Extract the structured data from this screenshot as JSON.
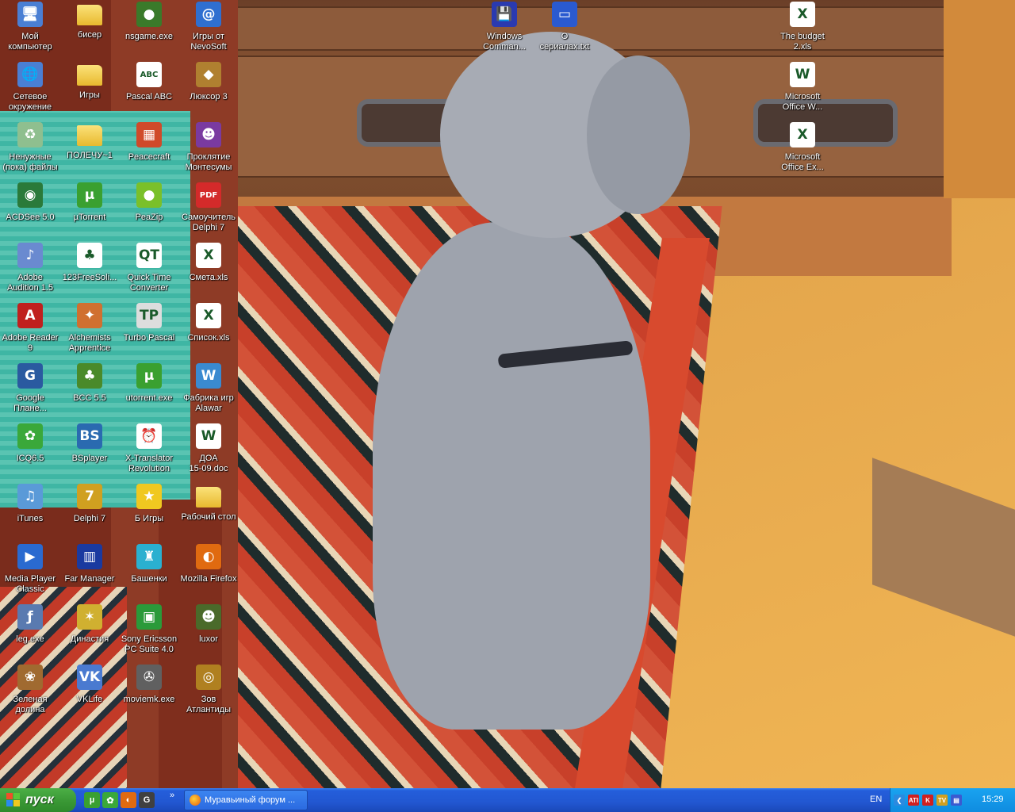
{
  "desktop_icons": [
    {
      "label": "Мой\nкомпьютер",
      "icon": "my-computer-icon",
      "color": "#4a7fd4",
      "glyph": "🖥"
    },
    {
      "label": "бисер",
      "icon": "folder-icon",
      "color": "#f0c846",
      "glyph": ""
    },
    {
      "label": "nsgame.exe",
      "icon": "nsgame-icon",
      "color": "#3a7a2a",
      "glyph": "●"
    },
    {
      "label": "Игры от\nNevoSoft",
      "icon": "nevosoft-icon",
      "color": "#2f6fd0",
      "glyph": "@"
    },
    {
      "label": "Сетевое\nокружение",
      "icon": "network-places-icon",
      "color": "#4a7fd4",
      "glyph": "🌐"
    },
    {
      "label": "Игры",
      "icon": "folder-icon",
      "color": "#f0c846",
      "glyph": ""
    },
    {
      "label": "Pascal ABC",
      "icon": "pascal-abc-icon",
      "color": "#ffffff",
      "glyph": "ABC"
    },
    {
      "label": "Люксор 3",
      "icon": "luxor3-icon",
      "color": "#b08030",
      "glyph": "◆"
    },
    {
      "label": "Ненужные\n(пока) файлы",
      "icon": "recycle-bin-icon",
      "color": "#8fbf8f",
      "glyph": "♻"
    },
    {
      "label": "ПОЛЕЧУ~1",
      "icon": "folder-icon",
      "color": "#f0c846",
      "glyph": ""
    },
    {
      "label": "Peacecraft",
      "icon": "peacecraft-icon",
      "color": "#d04a2a",
      "glyph": "▦"
    },
    {
      "label": "Проклятие\nМонтесумы",
      "icon": "montezuma-icon",
      "color": "#7a3aa0",
      "glyph": "☻"
    },
    {
      "label": "ACDSee 5.0",
      "icon": "acdsee-icon",
      "color": "#2a7a3a",
      "glyph": "◉"
    },
    {
      "label": "µTorrent",
      "icon": "utorrent-icon",
      "color": "#3aa030",
      "glyph": "µ"
    },
    {
      "label": "PeaZip",
      "icon": "peazip-icon",
      "color": "#7ac02a",
      "glyph": "●"
    },
    {
      "label": "Самоучитель\nDelphi 7",
      "icon": "pdf-icon",
      "color": "#d42a2a",
      "glyph": "PDF"
    },
    {
      "label": "Adobe\nAudition 1.5",
      "icon": "adobe-audition-icon",
      "color": "#6a8ad0",
      "glyph": "♪"
    },
    {
      "label": "123FreeSoli...",
      "icon": "solitaire-icon",
      "color": "#ffffff",
      "glyph": "♣"
    },
    {
      "label": "Quick Time\nConverter",
      "icon": "quicktime-converter-icon",
      "color": "#ffffff",
      "glyph": "QT"
    },
    {
      "label": "Смета.xls",
      "icon": "excel-file-icon",
      "color": "#ffffff",
      "glyph": "X"
    },
    {
      "label": "Adobe Reader\n9",
      "icon": "adobe-reader-icon",
      "color": "#c0201e",
      "glyph": "A"
    },
    {
      "label": "Alchemists\nApprentice",
      "icon": "alchemists-icon",
      "color": "#d07030",
      "glyph": "✦"
    },
    {
      "label": "Turbo Pascal",
      "icon": "turbo-pascal-icon",
      "color": "#dddddd",
      "glyph": "TP"
    },
    {
      "label": "Список.xls",
      "icon": "excel-file-icon",
      "color": "#ffffff",
      "glyph": "X"
    },
    {
      "label": "Google\nПлане...",
      "icon": "google-earth-icon",
      "color": "#2a5aa0",
      "glyph": "G"
    },
    {
      "label": "BCC 5.5",
      "icon": "bcc-icon",
      "color": "#4a8a2a",
      "glyph": "♣"
    },
    {
      "label": "utorrent.exe",
      "icon": "utorrent-icon",
      "color": "#3aa030",
      "glyph": "µ"
    },
    {
      "label": "Фабрика игр\nAlawar",
      "icon": "alawar-icon",
      "color": "#3a8ad0",
      "glyph": "W"
    },
    {
      "label": "ICQ6.5",
      "icon": "icq-icon",
      "color": "#3aa83a",
      "glyph": "✿"
    },
    {
      "label": "BSplayer",
      "icon": "bsplayer-icon",
      "color": "#2a6ab0",
      "glyph": "BS"
    },
    {
      "label": "X-Translator\nRevolution",
      "icon": "clock-icon",
      "color": "#ffffff",
      "glyph": "⏰"
    },
    {
      "label": "ДОА\n15-09.doc",
      "icon": "word-file-icon",
      "color": "#ffffff",
      "glyph": "W"
    },
    {
      "label": "iTunes",
      "icon": "itunes-icon",
      "color": "#5a9ad8",
      "glyph": "♫"
    },
    {
      "label": "Delphi 7",
      "icon": "delphi-icon",
      "color": "#d0a020",
      "glyph": "7"
    },
    {
      "label": "Б Игры",
      "icon": "star-icon",
      "color": "#f0c820",
      "glyph": "★"
    },
    {
      "label": "Рабочий стол",
      "icon": "folder-icon",
      "color": "#f0c846",
      "glyph": ""
    },
    {
      "label": "Media Player\nClassic",
      "icon": "media-player-icon",
      "color": "#2a6ad0",
      "glyph": "▶"
    },
    {
      "label": "Far Manager",
      "icon": "far-manager-icon",
      "color": "#1a3aa0",
      "glyph": "▥"
    },
    {
      "label": "Башенки",
      "icon": "bashenki-icon",
      "color": "#2ab0d0",
      "glyph": "♜"
    },
    {
      "label": "Mozilla Firefox",
      "icon": "firefox-icon",
      "color": "#e06a10",
      "glyph": "◐"
    },
    {
      "label": "leg.exe",
      "icon": "flash-icon",
      "color": "#5a7ab0",
      "glyph": "ƒ"
    },
    {
      "label": "Династия",
      "icon": "dynasty-icon",
      "color": "#d0b030",
      "glyph": "✶"
    },
    {
      "label": "Sony Ericsson\nPC Suite 4.0",
      "icon": "sony-ericsson-icon",
      "color": "#2a9a3a",
      "glyph": "▣"
    },
    {
      "label": "luxor",
      "icon": "luxor-icon",
      "color": "#4a6a2a",
      "glyph": "☻"
    },
    {
      "label": "Зеленая\nдолина",
      "icon": "green-valley-icon",
      "color": "#a06a30",
      "glyph": "❀"
    },
    {
      "label": "VKLife",
      "icon": "vklife-icon",
      "color": "#4a7ad0",
      "glyph": "VK"
    },
    {
      "label": "moviemk.exe",
      "icon": "movie-maker-icon",
      "color": "#606060",
      "glyph": "✇"
    },
    {
      "label": "Зов\nАтлантиды",
      "icon": "atlantis-icon",
      "color": "#b08020",
      "glyph": "◎"
    },
    {
      "label": "Windows\nComman...",
      "icon": "floppy-icon",
      "color": "#2a3ab0",
      "glyph": "💾"
    },
    {
      "label": "О\nсериалах.txt",
      "icon": "text-file-icon",
      "color": "#2a5ad0",
      "glyph": "▭"
    },
    {
      "label": "The budget\n2.xls",
      "icon": "excel-file-icon",
      "color": "#ffffff",
      "glyph": "X"
    },
    {
      "label": "Microsoft\nOffice W...",
      "icon": "word-icon",
      "color": "#ffffff",
      "glyph": "W"
    },
    {
      "label": "Microsoft\nOffice Ex...",
      "icon": "excel-icon",
      "color": "#ffffff",
      "glyph": "X"
    }
  ],
  "taskbar": {
    "start_label": "пуск",
    "quick_launch": [
      {
        "icon": "utorrent-quick-icon",
        "color": "#3aa030",
        "glyph": "µ"
      },
      {
        "icon": "icq-quick-icon",
        "color": "#3aa83a",
        "glyph": "✿"
      },
      {
        "icon": "firefox-quick-icon",
        "color": "#e06a10",
        "glyph": "◐"
      },
      {
        "icon": "g-quick-icon",
        "color": "#404040",
        "glyph": "G"
      }
    ],
    "overflow": "»",
    "window_button": "Муравьиный форум ...",
    "language": "EN",
    "clock": "15:29"
  },
  "tray_icons": [
    {
      "icon": "tray-arrow-icon",
      "color": "#2a8ae0",
      "glyph": "❮"
    },
    {
      "icon": "ati-icon",
      "color": "#d02020",
      "glyph": "ATI"
    },
    {
      "icon": "kaspersky-icon",
      "color": "#d02020",
      "glyph": "K"
    },
    {
      "icon": "tv-icon",
      "color": "#d0a020",
      "glyph": "TV"
    },
    {
      "icon": "flag-icon",
      "color": "#3a5ad0",
      "glyph": "▤"
    }
  ]
}
